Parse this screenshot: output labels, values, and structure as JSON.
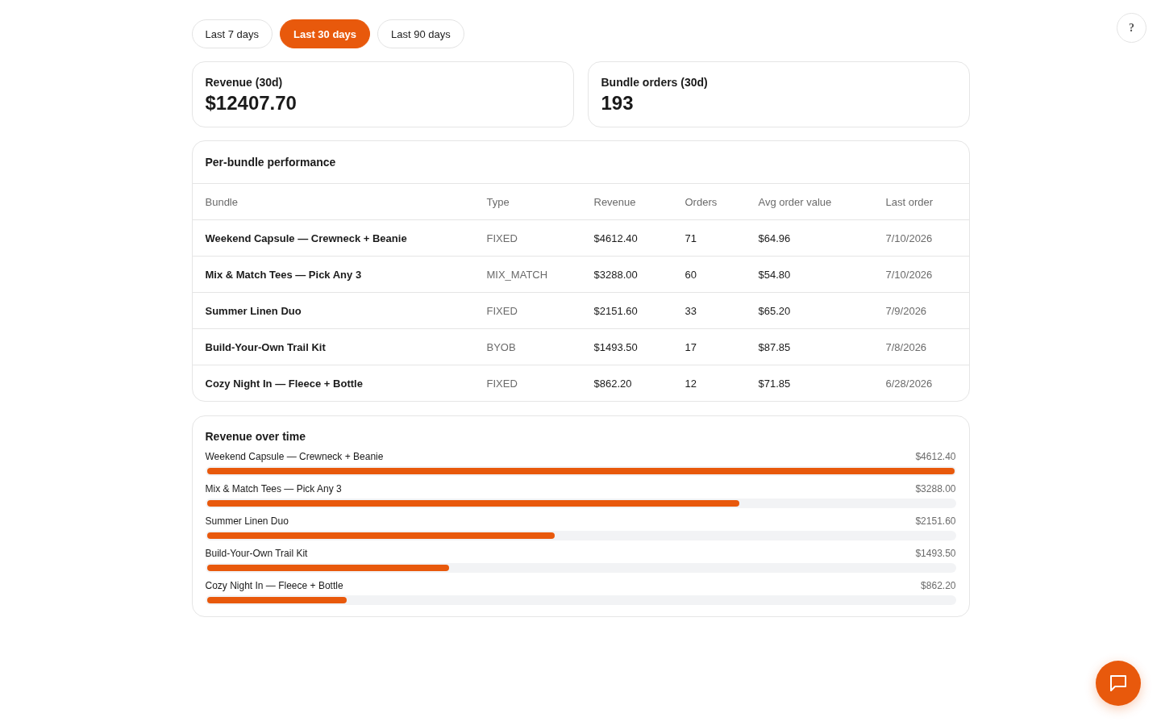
{
  "range_tabs": [
    {
      "label": "Last 7 days",
      "selected": false
    },
    {
      "label": "Last 30 days",
      "selected": true
    },
    {
      "label": "Last 90 days",
      "selected": false
    }
  ],
  "help_button": {
    "label": "?"
  },
  "stats": [
    {
      "label": "Revenue (30d)",
      "value": "$12407.70"
    },
    {
      "label": "Bundle orders (30d)",
      "value": "193"
    }
  ],
  "performance_table": {
    "title": "Per-bundle performance",
    "columns": [
      "Bundle",
      "Type",
      "Revenue",
      "Orders",
      "Avg order value",
      "Last order"
    ],
    "rows": [
      {
        "bundle": "Weekend Capsule — Crewneck + Beanie",
        "type": "FIXED",
        "revenue": "$4612.40",
        "orders": "71",
        "avg_order_value": "$64.96",
        "last_order": "7/10/2026"
      },
      {
        "bundle": "Mix & Match Tees — Pick Any 3",
        "type": "MIX_MATCH",
        "revenue": "$3288.00",
        "orders": "60",
        "avg_order_value": "$54.80",
        "last_order": "7/10/2026"
      },
      {
        "bundle": "Summer Linen Duo",
        "type": "FIXED",
        "revenue": "$2151.60",
        "orders": "33",
        "avg_order_value": "$65.20",
        "last_order": "7/9/2026"
      },
      {
        "bundle": "Build-Your-Own Trail Kit",
        "type": "BYOB",
        "revenue": "$1493.50",
        "orders": "17",
        "avg_order_value": "$87.85",
        "last_order": "7/8/2026"
      },
      {
        "bundle": "Cozy Night In — Fleece + Bottle",
        "type": "FIXED",
        "revenue": "$862.20",
        "orders": "12",
        "avg_order_value": "$71.85",
        "last_order": "6/28/2026"
      }
    ]
  },
  "revenue_over_time": {
    "title": "Revenue over time",
    "items": [
      {
        "name": "Weekend Capsule — Crewneck + Beanie",
        "amount": "$4612.40",
        "level": 1.0
      },
      {
        "name": "Mix & Match Tees — Pick Any 3",
        "amount": "$3288.00",
        "level": 0.713
      },
      {
        "name": "Summer Linen Duo",
        "amount": "$2151.60",
        "level": 0.466
      },
      {
        "name": "Build-Your-Own Trail Kit",
        "amount": "$1493.50",
        "level": 0.324
      },
      {
        "name": "Cozy Night In — Fleece + Bottle",
        "amount": "$862.20",
        "level": 0.187
      }
    ]
  }
}
